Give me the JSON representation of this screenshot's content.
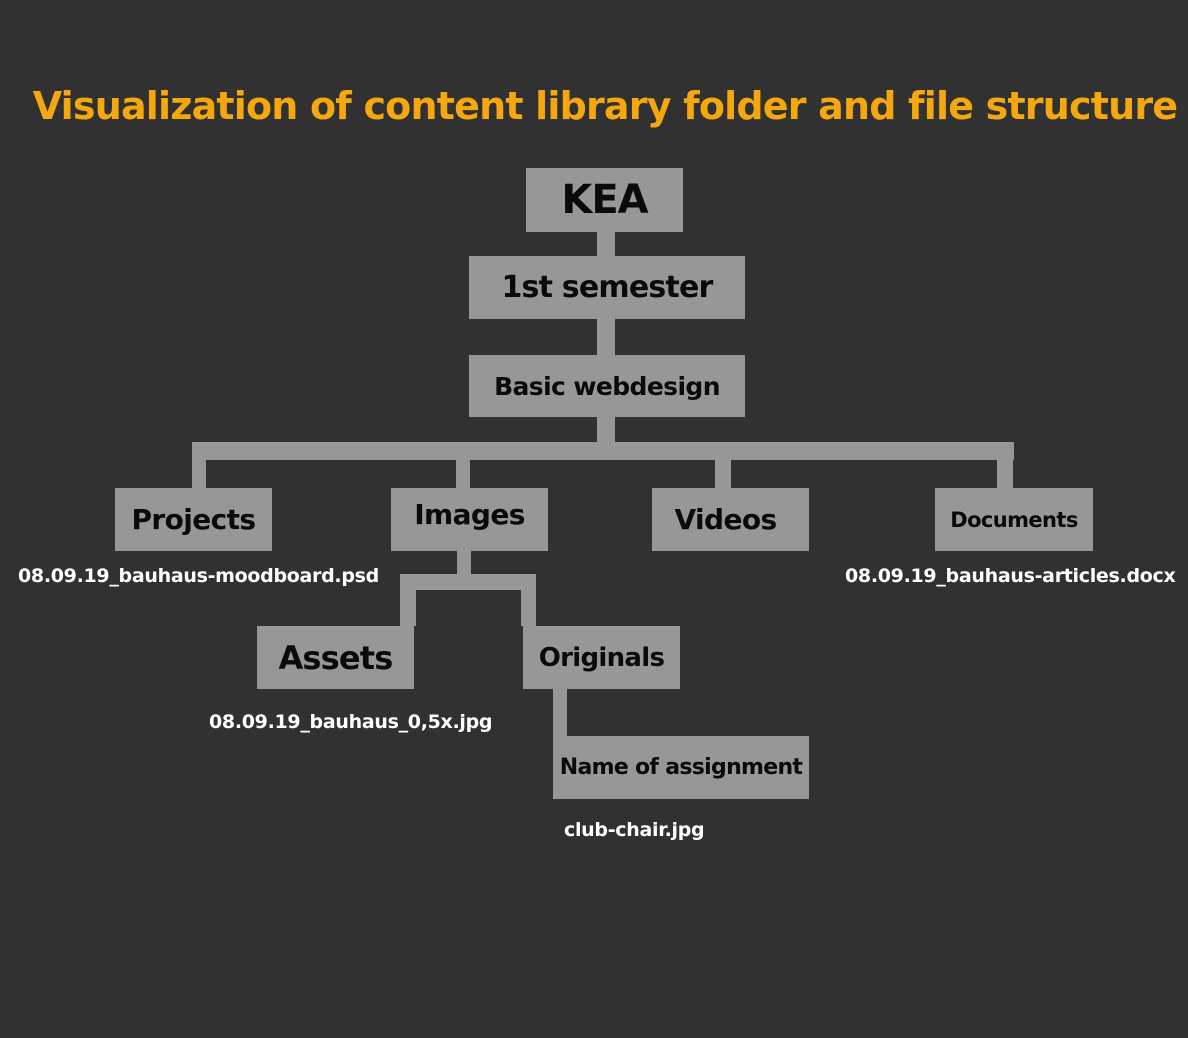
{
  "title": "Visualization of content library folder and file structure",
  "colors": {
    "background": "#313131",
    "title": "#f4a70f",
    "node_fill": "#979797",
    "connector": "#979797",
    "node_text": "#0a0a0a",
    "file_text": "#ffffff"
  },
  "nodes": {
    "kea": "KEA",
    "semester": "1st semester",
    "basic_webdesign": "Basic webdesign",
    "projects": "Projects",
    "images": "Images",
    "videos": "Videos",
    "documents": "Documents",
    "assets": "Assets",
    "originals": "Originals",
    "name_of_assignment": "Name of assignment"
  },
  "files": {
    "projects_file": "08.09.19_bauhaus-moodboard.psd",
    "documents_file": "08.09.19_bauhaus-articles.docx",
    "assets_file": "08.09.19_bauhaus_0,5x.jpg",
    "assignment_file": "club-chair.jpg"
  }
}
